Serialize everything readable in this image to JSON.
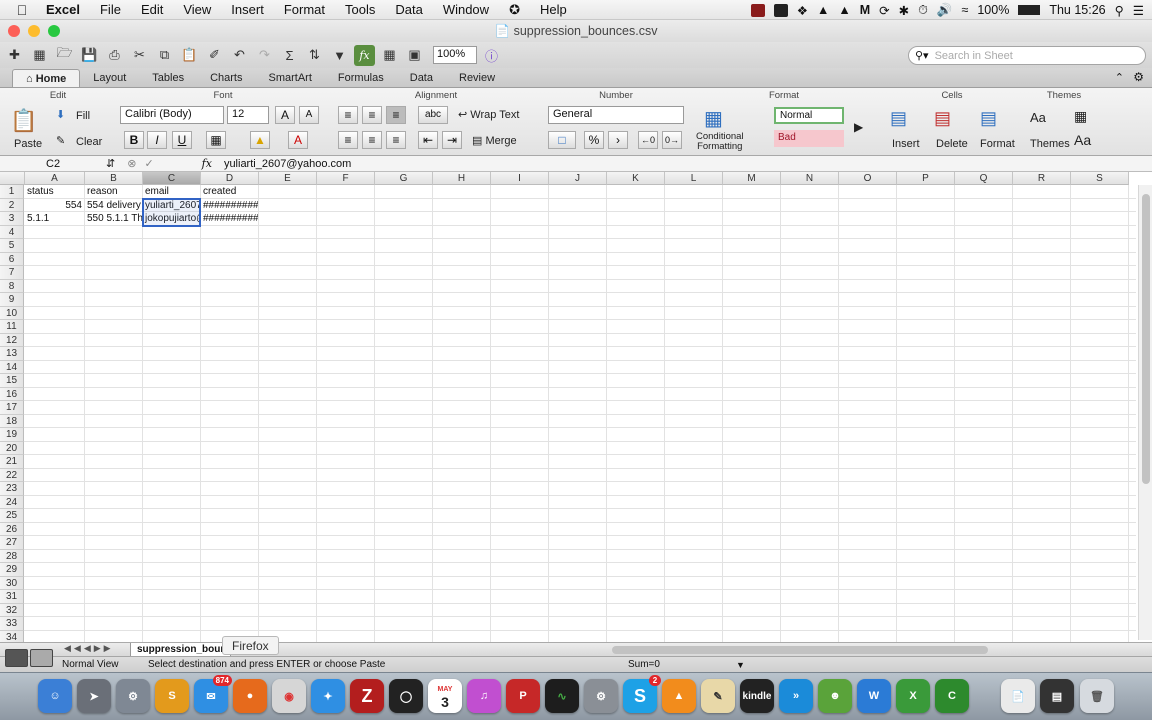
{
  "menubar": {
    "app": "Excel",
    "items": [
      "File",
      "Edit",
      "View",
      "Insert",
      "Format",
      "Tools",
      "Data",
      "Window",
      "Help"
    ],
    "battery": "100%",
    "clock": "Thu 15:26"
  },
  "window": {
    "title": "suppression_bounces.csv"
  },
  "toolbar": {
    "zoom": "100%",
    "search_placeholder": "Search in Sheet",
    "sum_symbol": "Σ",
    "fx_label": "fx"
  },
  "ribbon": {
    "tabs": [
      "Home",
      "Layout",
      "Tables",
      "Charts",
      "SmartArt",
      "Formulas",
      "Data",
      "Review"
    ],
    "groups": {
      "edit": "Edit",
      "font": "Font",
      "alignment": "Alignment",
      "number": "Number",
      "format": "Format",
      "cells": "Cells",
      "themes": "Themes"
    },
    "paste": "Paste",
    "fill": "Fill",
    "clear": "Clear",
    "font_name": "Calibri (Body)",
    "font_size": "12",
    "bold": "B",
    "italic": "I",
    "underline": "U",
    "wrap_text": "Wrap Text",
    "merge": "Merge",
    "abc": "abc",
    "number_format": "General",
    "percent": "%",
    "comma": "›",
    "conditional_formatting": [
      "Conditional",
      "Formatting"
    ],
    "style_normal": "Normal",
    "style_bad": "Bad",
    "insert": "Insert",
    "delete": "Delete",
    "format": "Format",
    "themes": "Themes",
    "aa": "Aa"
  },
  "formula_bar": {
    "name_box": "C2",
    "fx": "fx",
    "formula": "yuliarti_2607@yahoo.com"
  },
  "grid": {
    "columns": [
      "A",
      "B",
      "C",
      "D",
      "E",
      "F",
      "G",
      "H",
      "I",
      "J",
      "K",
      "L",
      "M",
      "N",
      "O",
      "P",
      "Q",
      "R",
      "S"
    ],
    "selected_column": "C",
    "rows": [
      "1",
      "2",
      "3",
      "4",
      "5",
      "6",
      "7",
      "8",
      "9",
      "10",
      "11",
      "12",
      "13",
      "14",
      "15",
      "16",
      "17",
      "18",
      "19",
      "20",
      "21",
      "22",
      "23",
      "24",
      "25",
      "26",
      "27",
      "28",
      "29",
      "30",
      "31",
      "32",
      "33",
      "34"
    ],
    "cells": [
      {
        "col": "A",
        "row": 1,
        "text": "status"
      },
      {
        "col": "B",
        "row": 1,
        "text": "reason"
      },
      {
        "col": "C",
        "row": 1,
        "text": "email"
      },
      {
        "col": "D",
        "row": 1,
        "text": "created"
      },
      {
        "col": "A",
        "row": 2,
        "text": "554",
        "align": "right"
      },
      {
        "col": "B",
        "row": 2,
        "text": "554 delivery"
      },
      {
        "col": "C",
        "row": 2,
        "text": "yuliarti_2607"
      },
      {
        "col": "D",
        "row": 2,
        "text": "##########"
      },
      {
        "col": "A",
        "row": 3,
        "text": "5.1.1"
      },
      {
        "col": "B",
        "row": 3,
        "text": "550 5.1.1 Th"
      },
      {
        "col": "C",
        "row": 3,
        "text": "jokopujiarto@"
      },
      {
        "col": "D",
        "row": 3,
        "text": "##########"
      }
    ]
  },
  "sheet_tabs": {
    "active": "suppression_bour",
    "tooltip": "Firefox"
  },
  "status": {
    "view": "Normal View",
    "message": "Select destination and press ENTER or choose Paste",
    "sum": "Sum=0"
  },
  "dock": {
    "mail_badge": "874",
    "skype_badge": "2",
    "calendar_day": "3",
    "calendar_month": "MAY",
    "kindle": "kindle"
  },
  "colors": {
    "selection": "#3163c5",
    "fx_button": "#5a8e3f",
    "style_bad_bg": "#f6c7cd"
  }
}
